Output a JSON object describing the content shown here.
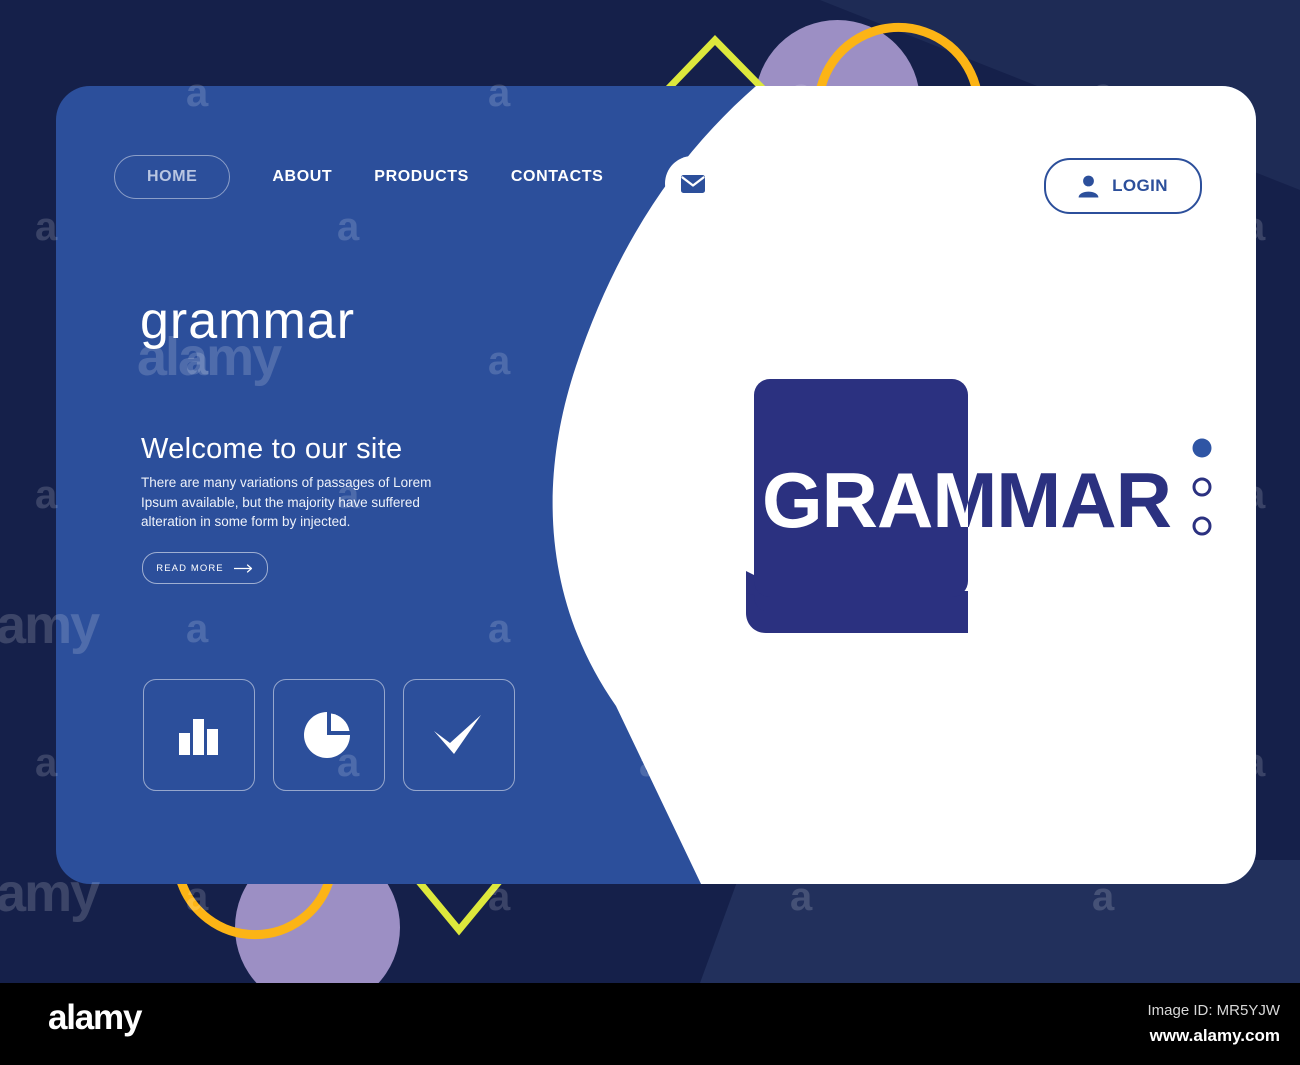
{
  "colors": {
    "background_navy": "#15204A",
    "card_blue": "#2C4F9B",
    "logo_navy": "#2B3180",
    "white": "#FFFFFF",
    "accent_purple": "#9C8FC4",
    "accent_yellow": "#DDE83C",
    "accent_orange": "#FCB415",
    "dot_blue": "#2F55A4"
  },
  "nav": {
    "home_label": "HOME",
    "items": [
      {
        "label": "ABOUT"
      },
      {
        "label": "PRODUCTS"
      },
      {
        "label": "CONTACTS"
      }
    ],
    "mail_icon": "envelope-icon",
    "login": {
      "label": "LOGIN",
      "icon": "user-icon"
    }
  },
  "hero": {
    "brand": "grammar",
    "heading": "Welcome to our site",
    "paragraph": "There are many variations of passages of Lorem Ipsum available, but the majority have suffered alteration in some form by injected.",
    "cta_label": "READ MORE",
    "cta_icon": "arrow-right-icon"
  },
  "features": [
    {
      "icon": "bar-chart-icon",
      "name": "feature-bar-chart"
    },
    {
      "icon": "pie-chart-icon",
      "name": "feature-pie-chart"
    },
    {
      "icon": "check-icon",
      "name": "feature-check"
    }
  ],
  "logo": {
    "wordmark": "GRAMMAR",
    "icon": "book-icon",
    "dots": [
      {
        "style": "filled"
      },
      {
        "style": "outline"
      },
      {
        "style": "outline"
      }
    ]
  },
  "watermark": {
    "letter": "a",
    "word": "alamy"
  },
  "footer": {
    "brand": "alamy",
    "image_id": "Image ID: MR5YJW",
    "url": "www.alamy.com"
  }
}
